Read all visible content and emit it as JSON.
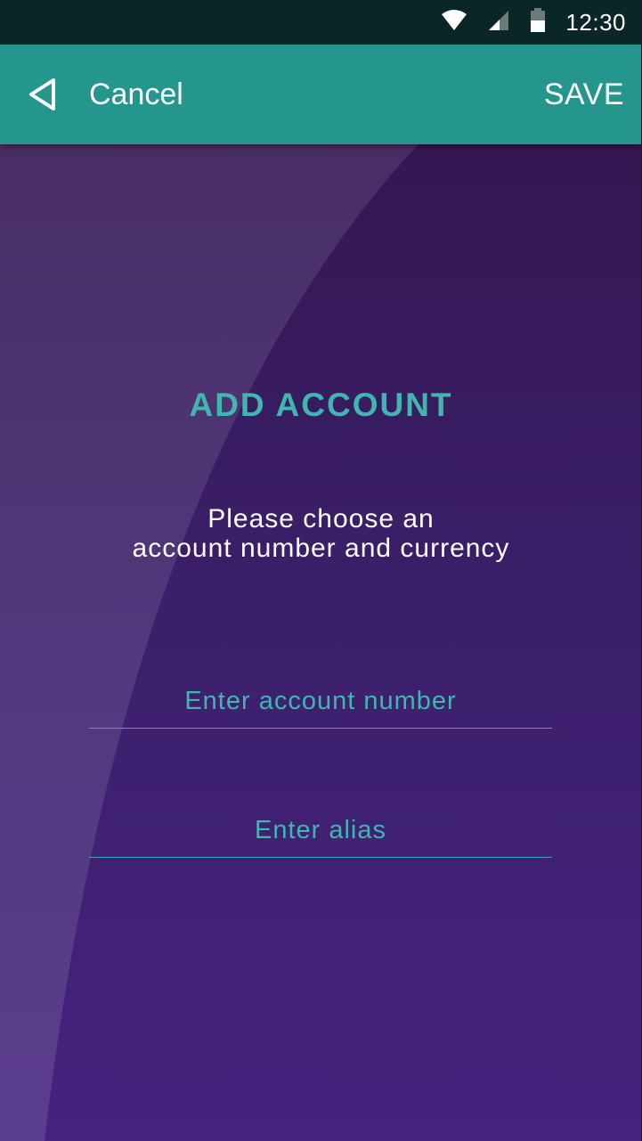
{
  "status_bar": {
    "time": "12:30",
    "icons": [
      "wifi-icon",
      "cellular-signal-icon",
      "battery-icon"
    ]
  },
  "app_bar": {
    "back_icon": "back-triangle-icon",
    "cancel_label": "Cancel",
    "save_label": "SAVE",
    "color": "#24968d"
  },
  "main": {
    "title": "ADD ACCOUNT",
    "subtitle_line1": "Please choose an",
    "subtitle_line2": "account number and currency",
    "account_number": {
      "placeholder": "Enter account number",
      "value": ""
    },
    "alias": {
      "placeholder": "Enter alias",
      "value": ""
    }
  },
  "colors": {
    "accent": "#3fb6ae",
    "status_bar": "#0b2627",
    "background_top": "#341752",
    "background_bottom": "#45237f"
  }
}
